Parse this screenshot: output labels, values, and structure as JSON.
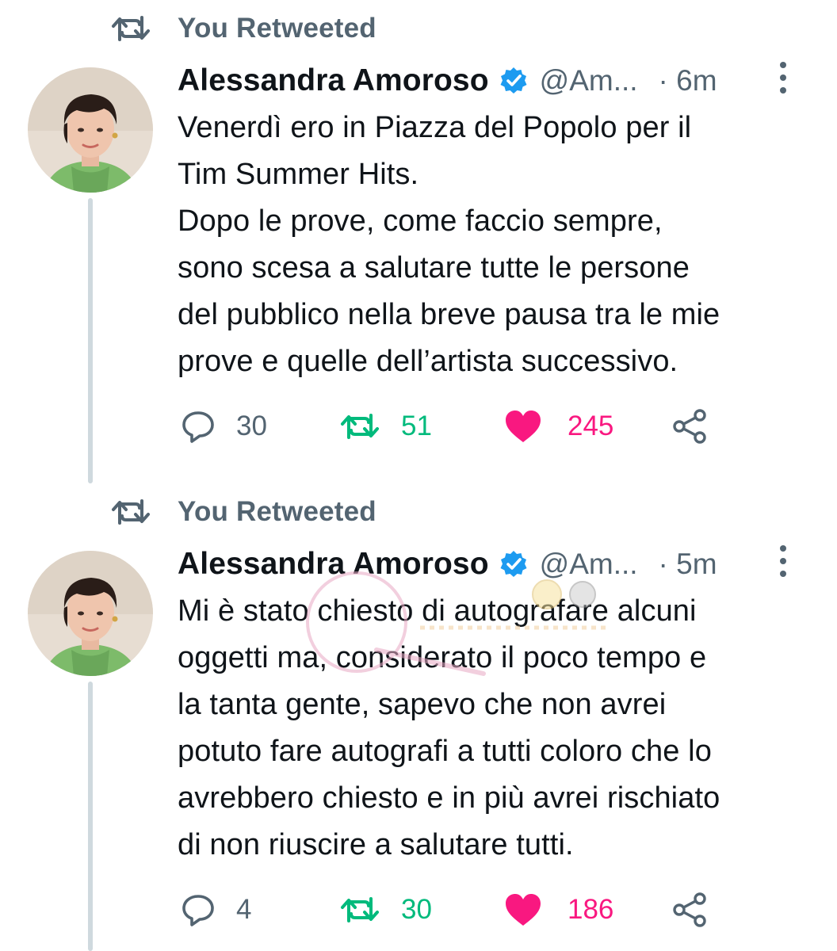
{
  "colors": {
    "retweet_green": "#00ba7c",
    "like_pink": "#f91880",
    "muted_gray": "#536471",
    "verified_blue": "#1d9bf0"
  },
  "tweets": [
    {
      "retweet_label": "You Retweeted",
      "author_name": "Alessandra Amoroso",
      "handle": "@Am...",
      "time": "· 6m",
      "text": "Venerdì ero in Piazza del Popolo per il\nTim Summer Hits.\nDopo le prove, come faccio sempre,\nsono scesa a salutare tutte le persone\ndel pubblico nella breve pausa tra le mie\nprove e quelle dell’artista successivo.",
      "replies": "30",
      "retweets": "51",
      "likes": "245"
    },
    {
      "retweet_label": "You Retweeted",
      "author_name": "Alessandra Amoroso",
      "handle": "@Am...",
      "time": "· 5m",
      "text": "Mi è stato chiesto di autografare alcuni\noggetti ma, considerato il poco tempo e\nla tanta gente, sapevo che non avrei\npotuto fare autografi a tutti coloro che lo\navrebbero chiesto e in più avrei rischiato\ndi non riuscire a salutare tutti.",
      "replies": "4",
      "retweets": "30",
      "likes": "186"
    }
  ],
  "icons": {
    "retweet": "retweet-icon",
    "verified": "verified-badge-icon",
    "more": "more-vertical-icon",
    "reply": "reply-bubble-icon",
    "like": "heart-filled-icon",
    "share": "share-icon"
  }
}
